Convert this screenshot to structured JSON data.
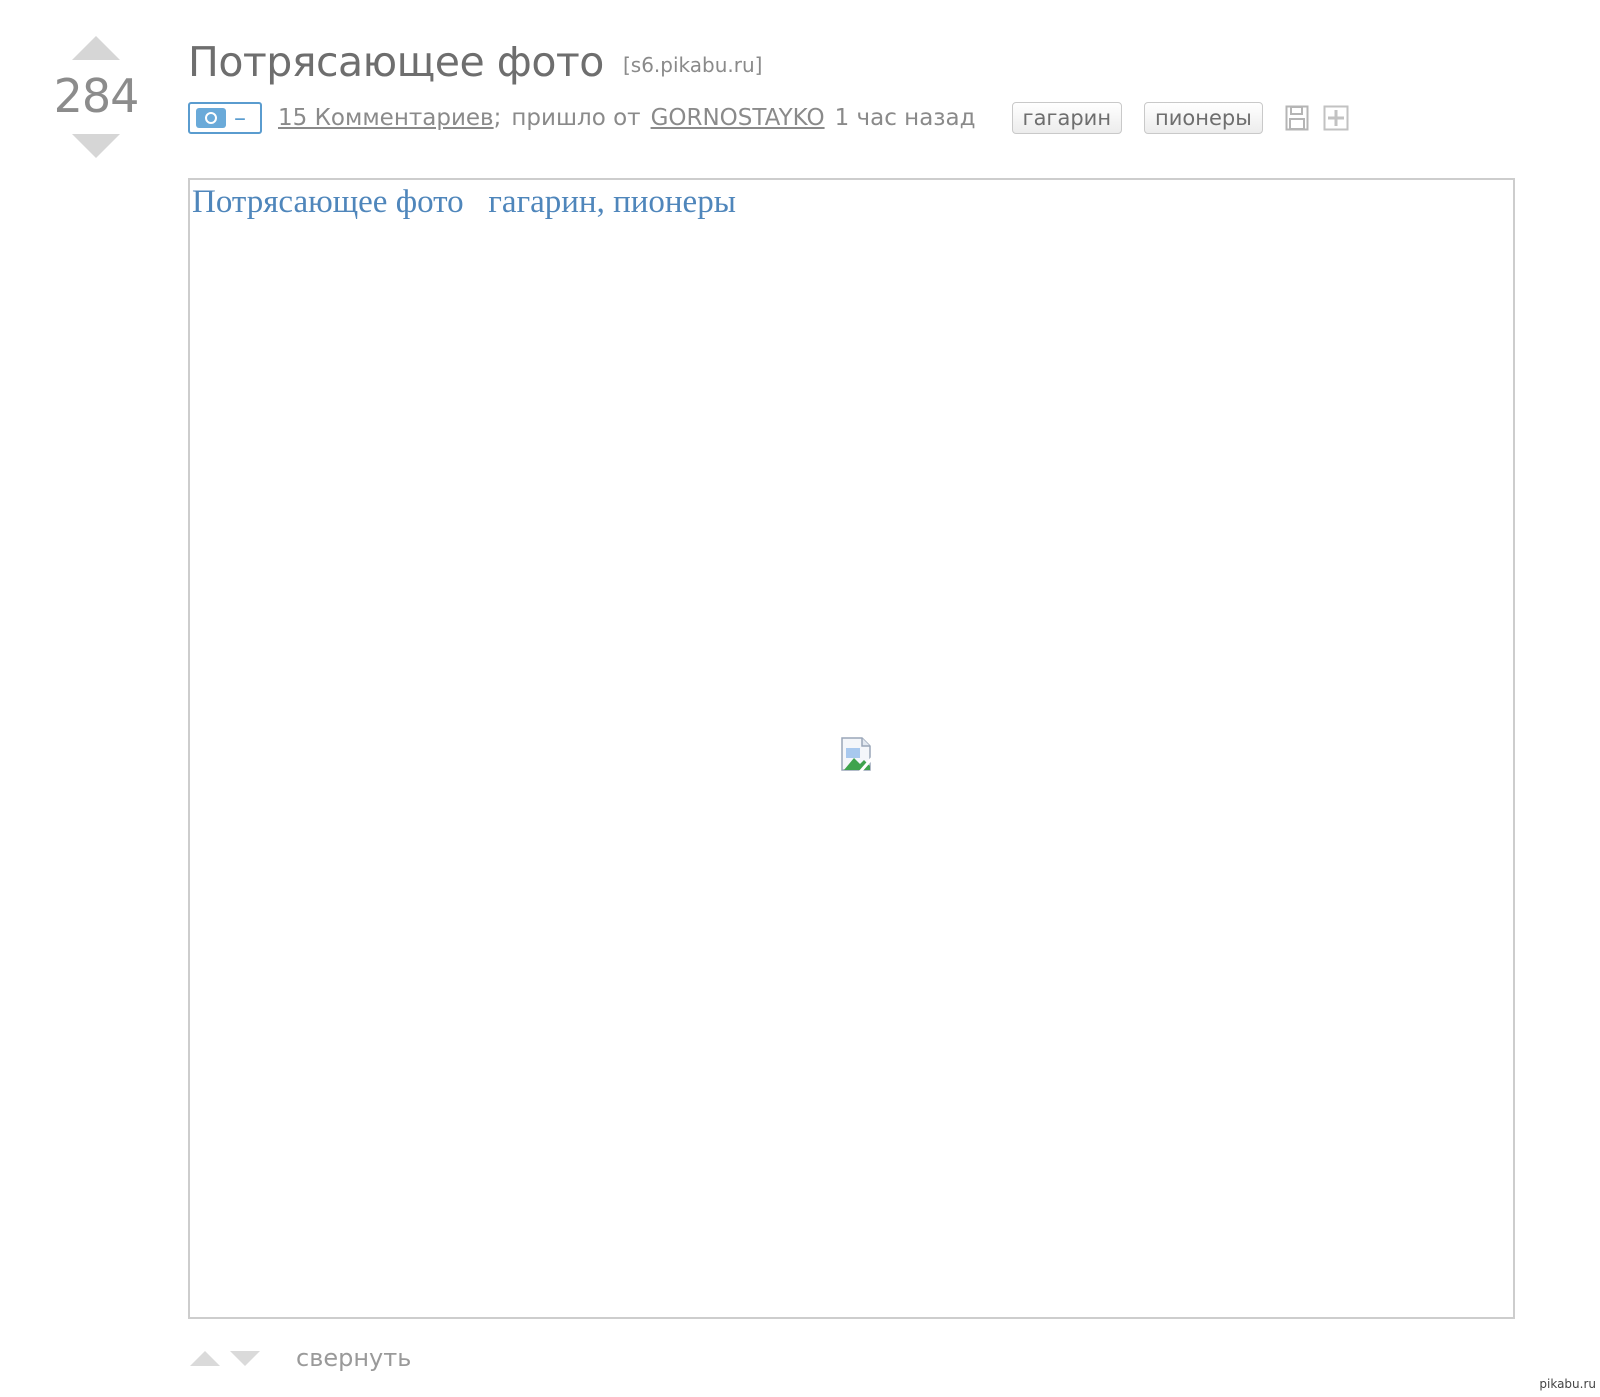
{
  "post": {
    "rating": "284",
    "title": "Потрясающее фото",
    "domain": "[s6.pikabu.ru]",
    "comments_link": "15 Комментариев",
    "separator": ";",
    "from_text": "пришло от",
    "author": "GORNOSTAYKO",
    "time_ago": "1 час назад",
    "tags": [
      "гагарин",
      "пионеры"
    ],
    "image_alt": "Потрясающее фото   гагарин, пионеры",
    "collapse_label": "свернуть",
    "minus_glyph": "–"
  },
  "icons": {
    "vote_up": "arrow-up-icon",
    "vote_down": "arrow-down-icon",
    "photo_toggle": "camera-icon",
    "save": "save-icon",
    "add": "plus-icon",
    "broken_image": "broken-image-icon"
  },
  "colors": {
    "accent_blue": "#5a9ccf",
    "alt_text_blue": "#4f86bb",
    "text_gray": "#8a8a8a",
    "arrow_gray": "#d6d6d6"
  },
  "watermark": "pikabu.ru"
}
